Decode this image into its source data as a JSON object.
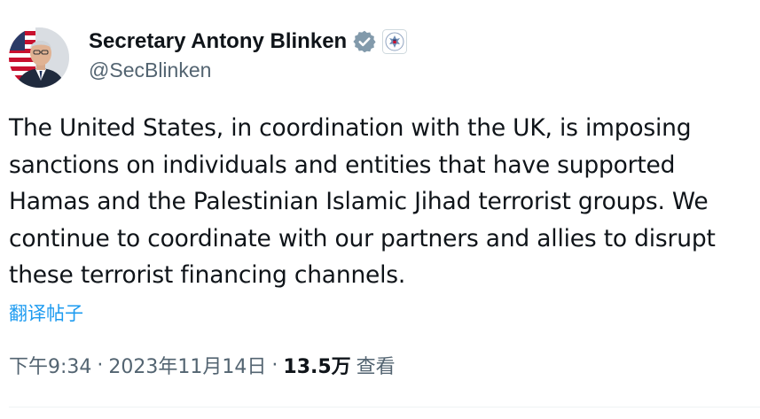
{
  "author": {
    "display_name": "Secretary Antony Blinken",
    "handle": "@SecBlinken",
    "verified_badge_icon": "verified-badge-icon",
    "affiliate_icon": "us-state-dept-seal-icon",
    "badge_color": "#829aab"
  },
  "tweet": {
    "text": "The United States, in coordination with the UK, is imposing\nsanctions on individuals and entities that have supported\nHamas and the Palestinian Islamic Jihad terrorist groups. We\ncontinue to coordinate with our partners and allies to disrupt\nthese terrorist financing channels.",
    "translate_label": "翻译帖子"
  },
  "meta": {
    "time": "下午9:34",
    "date": "2023年11月14日",
    "separator": "·",
    "views_count": "13.5万",
    "views_label": "查看"
  },
  "colors": {
    "text": "#0f1419",
    "secondary": "#536471",
    "link": "#1d9bf0"
  }
}
